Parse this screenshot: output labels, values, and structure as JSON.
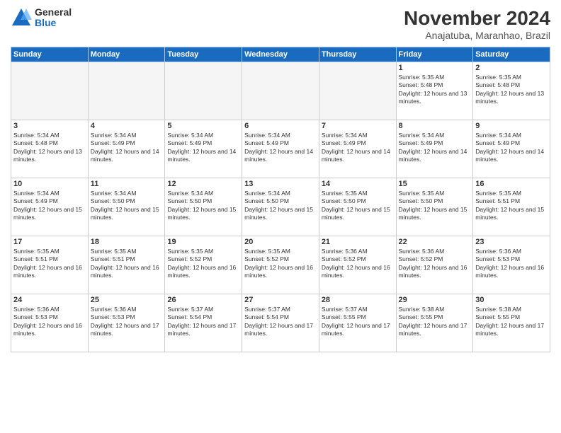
{
  "header": {
    "logo": {
      "general": "General",
      "blue": "Blue"
    },
    "title": "November 2024",
    "location": "Anajatuba, Maranhao, Brazil"
  },
  "weekdays": [
    "Sunday",
    "Monday",
    "Tuesday",
    "Wednesday",
    "Thursday",
    "Friday",
    "Saturday"
  ],
  "weeks": [
    [
      {
        "day": "",
        "info": ""
      },
      {
        "day": "",
        "info": ""
      },
      {
        "day": "",
        "info": ""
      },
      {
        "day": "",
        "info": ""
      },
      {
        "day": "",
        "info": ""
      },
      {
        "day": "1",
        "info": "Sunrise: 5:35 AM\nSunset: 5:48 PM\nDaylight: 12 hours and 13 minutes."
      },
      {
        "day": "2",
        "info": "Sunrise: 5:35 AM\nSunset: 5:48 PM\nDaylight: 12 hours and 13 minutes."
      }
    ],
    [
      {
        "day": "3",
        "info": "Sunrise: 5:34 AM\nSunset: 5:48 PM\nDaylight: 12 hours and 13 minutes."
      },
      {
        "day": "4",
        "info": "Sunrise: 5:34 AM\nSunset: 5:49 PM\nDaylight: 12 hours and 14 minutes."
      },
      {
        "day": "5",
        "info": "Sunrise: 5:34 AM\nSunset: 5:49 PM\nDaylight: 12 hours and 14 minutes."
      },
      {
        "day": "6",
        "info": "Sunrise: 5:34 AM\nSunset: 5:49 PM\nDaylight: 12 hours and 14 minutes."
      },
      {
        "day": "7",
        "info": "Sunrise: 5:34 AM\nSunset: 5:49 PM\nDaylight: 12 hours and 14 minutes."
      },
      {
        "day": "8",
        "info": "Sunrise: 5:34 AM\nSunset: 5:49 PM\nDaylight: 12 hours and 14 minutes."
      },
      {
        "day": "9",
        "info": "Sunrise: 5:34 AM\nSunset: 5:49 PM\nDaylight: 12 hours and 14 minutes."
      }
    ],
    [
      {
        "day": "10",
        "info": "Sunrise: 5:34 AM\nSunset: 5:49 PM\nDaylight: 12 hours and 15 minutes."
      },
      {
        "day": "11",
        "info": "Sunrise: 5:34 AM\nSunset: 5:50 PM\nDaylight: 12 hours and 15 minutes."
      },
      {
        "day": "12",
        "info": "Sunrise: 5:34 AM\nSunset: 5:50 PM\nDaylight: 12 hours and 15 minutes."
      },
      {
        "day": "13",
        "info": "Sunrise: 5:34 AM\nSunset: 5:50 PM\nDaylight: 12 hours and 15 minutes."
      },
      {
        "day": "14",
        "info": "Sunrise: 5:35 AM\nSunset: 5:50 PM\nDaylight: 12 hours and 15 minutes."
      },
      {
        "day": "15",
        "info": "Sunrise: 5:35 AM\nSunset: 5:50 PM\nDaylight: 12 hours and 15 minutes."
      },
      {
        "day": "16",
        "info": "Sunrise: 5:35 AM\nSunset: 5:51 PM\nDaylight: 12 hours and 15 minutes."
      }
    ],
    [
      {
        "day": "17",
        "info": "Sunrise: 5:35 AM\nSunset: 5:51 PM\nDaylight: 12 hours and 16 minutes."
      },
      {
        "day": "18",
        "info": "Sunrise: 5:35 AM\nSunset: 5:51 PM\nDaylight: 12 hours and 16 minutes."
      },
      {
        "day": "19",
        "info": "Sunrise: 5:35 AM\nSunset: 5:52 PM\nDaylight: 12 hours and 16 minutes."
      },
      {
        "day": "20",
        "info": "Sunrise: 5:35 AM\nSunset: 5:52 PM\nDaylight: 12 hours and 16 minutes."
      },
      {
        "day": "21",
        "info": "Sunrise: 5:36 AM\nSunset: 5:52 PM\nDaylight: 12 hours and 16 minutes."
      },
      {
        "day": "22",
        "info": "Sunrise: 5:36 AM\nSunset: 5:52 PM\nDaylight: 12 hours and 16 minutes."
      },
      {
        "day": "23",
        "info": "Sunrise: 5:36 AM\nSunset: 5:53 PM\nDaylight: 12 hours and 16 minutes."
      }
    ],
    [
      {
        "day": "24",
        "info": "Sunrise: 5:36 AM\nSunset: 5:53 PM\nDaylight: 12 hours and 16 minutes."
      },
      {
        "day": "25",
        "info": "Sunrise: 5:36 AM\nSunset: 5:53 PM\nDaylight: 12 hours and 17 minutes."
      },
      {
        "day": "26",
        "info": "Sunrise: 5:37 AM\nSunset: 5:54 PM\nDaylight: 12 hours and 17 minutes."
      },
      {
        "day": "27",
        "info": "Sunrise: 5:37 AM\nSunset: 5:54 PM\nDaylight: 12 hours and 17 minutes."
      },
      {
        "day": "28",
        "info": "Sunrise: 5:37 AM\nSunset: 5:55 PM\nDaylight: 12 hours and 17 minutes."
      },
      {
        "day": "29",
        "info": "Sunrise: 5:38 AM\nSunset: 5:55 PM\nDaylight: 12 hours and 17 minutes."
      },
      {
        "day": "30",
        "info": "Sunrise: 5:38 AM\nSunset: 5:55 PM\nDaylight: 12 hours and 17 minutes."
      }
    ]
  ]
}
